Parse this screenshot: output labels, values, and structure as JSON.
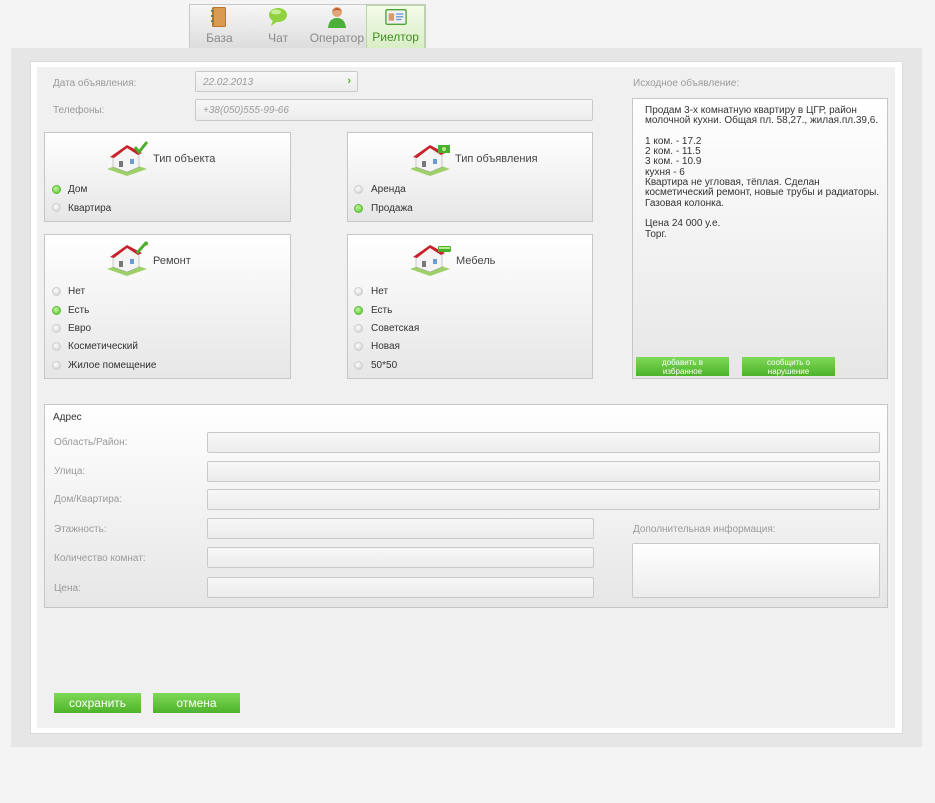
{
  "tabs": [
    {
      "label": "База",
      "icon": "notebook-icon"
    },
    {
      "label": "Чат",
      "icon": "chat-bubble-icon"
    },
    {
      "label": "Оператор",
      "icon": "operator-icon"
    },
    {
      "label": "Риелтор",
      "icon": "id-card-icon"
    }
  ],
  "active_tab": "Риелтор",
  "form": {
    "date_label": "Дата объявления:",
    "date_value": "22.02.2013",
    "phones_label": "Телефоны:",
    "phones_value": "+38(050)555-99-66"
  },
  "object_type": {
    "title": "Тип объекта",
    "options": [
      "Дом",
      "Квартира"
    ],
    "selected": "Дом"
  },
  "ad_type": {
    "title": "Тип объявления",
    "options": [
      "Аренда",
      "Продажа"
    ],
    "selected": "Продажа"
  },
  "repair": {
    "title": "Ремонт",
    "options": [
      "Нет",
      "Есть",
      "Евро",
      "Косметический",
      "Жилое помещение"
    ],
    "selected": "Есть"
  },
  "furniture": {
    "title": "Мебель",
    "options": [
      "Нет",
      "Есть",
      "Советская",
      "Новая",
      "50*50"
    ],
    "selected": "Есть"
  },
  "source_ad": {
    "label": "Исходное объявление:",
    "text": "Продам 3-х комнатную квартиру в ЦГР, район молочной кухни. Общая пл. 58,27., жилая.пл.39,6.\n\n1 ком. - 17.2\n2 ком. - 11.5\n3 ком. - 10.9\nкухня - 6\nКвартира не угловая, тёплая. Сделан косметический ремонт, новые трубы и радиаторы. Газовая колонка.\n\nЦена 24 000 у.е.\nТорг.",
    "favorite_button": "добавить в избранное",
    "report_button": "сообщить о нарушение"
  },
  "address": {
    "title": "Адрес",
    "region_label": "Область/Район:",
    "street_label": "Улица:",
    "house_label": "Дом/Квартира:",
    "floors_label": "Этажность:",
    "rooms_label": "Количество комнат:",
    "price_label": "Цена:",
    "extra_label": "Дополнительная информация:"
  },
  "actions": {
    "save": "сохранить",
    "cancel": "отмена"
  },
  "colors": {
    "accent_green": "#5cbd36"
  }
}
